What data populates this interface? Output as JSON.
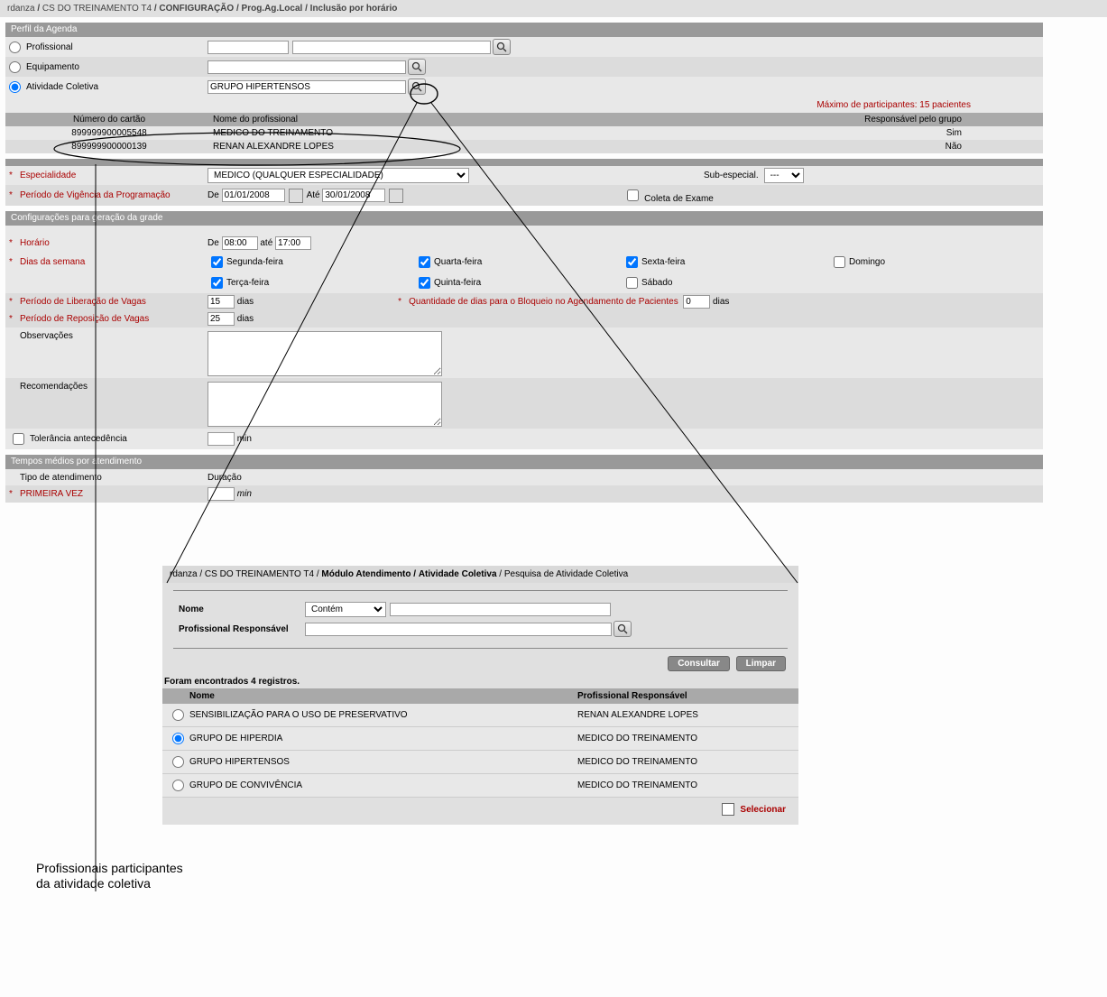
{
  "breadcrumb": {
    "p1": "rdanza",
    "p2": "CS DO TREINAMENTO T4",
    "p3": "CONFIGURAÇÃO",
    "p4": "Prog.Ag.Local",
    "p5": "Inclusão por horário"
  },
  "perfil": {
    "header": "Perfil da Agenda",
    "profissional_label": "Profissional",
    "equipamento_label": "Equipamento",
    "atividade_label": "Atividade Coletiva",
    "atividade_value": "GRUPO HIPERTENSOS",
    "max_text": "Máximo de participantes: 15 pacientes"
  },
  "prof_table": {
    "h_card": "Número do cartão",
    "h_name": "Nome do profissional",
    "h_resp": "Responsável pelo grupo",
    "rows": [
      {
        "card": "899999900005548",
        "name": "MEDICO DO TREINAMENTO",
        "resp": "Sim"
      },
      {
        "card": "899999900000139",
        "name": "RENAN ALEXANDRE LOPES",
        "resp": "Não"
      }
    ]
  },
  "especial": {
    "label": "Especialidade",
    "value": "MEDICO (QUALQUER ESPECIALIDADE)",
    "sub_label": "Sub-especial.",
    "sub_value": "---"
  },
  "periodo": {
    "label": "Período de Vigência da Programação",
    "de": "De",
    "ate": "Até",
    "d1": "01/01/2008",
    "d2": "30/01/2008",
    "coleta": "Coleta de Exame"
  },
  "grade": {
    "header": "Configurações para geração da grade",
    "horario_label": "Horário",
    "h_de": "De",
    "h_ate": "até",
    "h1": "08:00",
    "h2": "17:00",
    "dias_label": "Dias da semana",
    "d_seg": "Segunda-feira",
    "d_ter": "Terça-feira",
    "d_qua": "Quarta-feira",
    "d_qui": "Quinta-feira",
    "d_sex": "Sexta-feira",
    "d_sab": "Sábado",
    "d_dom": "Domingo",
    "lib_label": "Período de Liberação de Vagas",
    "lib_val": "15",
    "dias_txt": "dias",
    "bloq_label": "Quantidade de dias para o Bloqueio no Agendamento de Pacientes",
    "bloq_val": "0",
    "repo_label": "Período de Reposição de Vagas",
    "repo_val": "25",
    "obs_label": "Observações",
    "rec_label": "Recomendações",
    "tol_label": "Tolerância antecedência",
    "min": "min"
  },
  "tempos": {
    "header": "Tempos médios por atendimento",
    "tipo_label": "Tipo de atendimento",
    "dur_label": "Duração",
    "prim": "PRIMEIRA VEZ",
    "min": "min"
  },
  "sub": {
    "bc1": "rdanza",
    "bc2": "CS DO TREINAMENTO T4",
    "bc3": "Módulo Atendimento",
    "bc4": "Atividade Coletiva",
    "bc5": "Pesquisa de Atividade Coletiva",
    "nome_label": "Nome",
    "contem": "Contém",
    "prof_label": "Profissional Responsável",
    "consultar": "Consultar",
    "limpar": "Limpar",
    "found": "Foram encontrados 4 registros.",
    "h_nome": "Nome",
    "h_prof": "Profissional Responsável",
    "rows": [
      {
        "nome": "SENSIBILIZAÇÃO PARA O USO DE PRESERVATIVO",
        "prof": "RENAN ALEXANDRE LOPES",
        "sel": false
      },
      {
        "nome": "GRUPO DE HIPERDIA",
        "prof": "MEDICO DO TREINAMENTO",
        "sel": true
      },
      {
        "nome": "GRUPO HIPERTENSOS",
        "prof": "MEDICO DO TREINAMENTO",
        "sel": false
      },
      {
        "nome": "GRUPO DE CONVIVÊNCIA",
        "prof": "MEDICO DO TREINAMENTO",
        "sel": false
      }
    ],
    "selecionar": "Selecionar"
  },
  "annotation": {
    "line1": "Profissionais participantes",
    "line2": "da atividade coletiva"
  }
}
